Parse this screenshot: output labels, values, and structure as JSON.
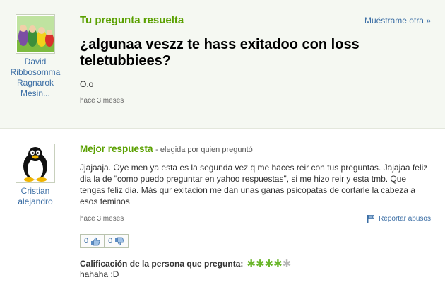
{
  "question": {
    "header": "Tu pregunta resuelta",
    "show_other": "Muéstrame otra »",
    "title": "¿algunaa veszz te hass exitadoo con loss teletubbiees?",
    "detail": "O.o",
    "time": "hace 3 meses",
    "asker": {
      "name": "David\nRibbosomma\nRagnarok\nMesin...",
      "avatar_icon": "teletubbies-avatar-icon"
    }
  },
  "answer": {
    "label": "Mejor respuesta",
    "chosen_by": "- elegida por quien preguntó",
    "text": "Jjajaaja. Oye men ya esta es la segunda vez q me haces reir con tus preguntas. Jajajaa feliz dia la de \"como puedo preguntar en yahoo respuestas\", si me hizo reir y esta tmb. Que tengas feliz dia. Más qur exitacion me dan unas ganas psicopatas de cortarle la cabeza a esos feminos",
    "time": "hace 3 meses",
    "report": "Reportar abusos",
    "answerer": {
      "name": "Cristian\nalejandro",
      "avatar_icon": "tux-penguin-avatar-icon"
    },
    "votes": {
      "up": "0",
      "down": "0",
      "up_icon": "thumbs-up-icon",
      "down_icon": "thumbs-down-icon"
    },
    "rating": {
      "label": "Calificación de la persona que pregunta:",
      "stars_filled": 4,
      "stars_total": 5,
      "comment": "hahaha :D"
    }
  },
  "colors": {
    "accent_green": "#5aa000",
    "link_blue": "#3b6ea5",
    "question_bg": "#f5f8f2"
  }
}
